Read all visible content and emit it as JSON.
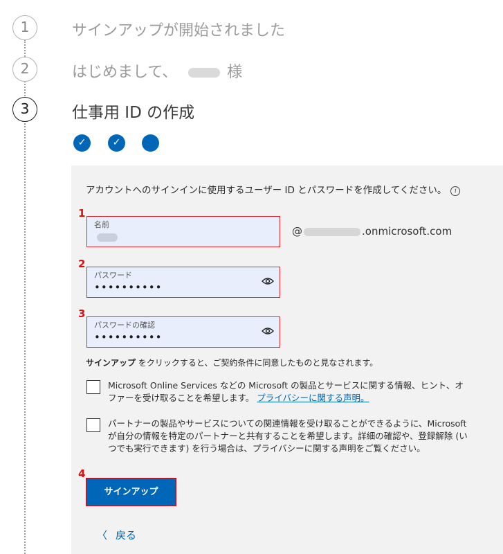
{
  "steps": [
    {
      "number": "1",
      "title": "サインアップが開始されました"
    },
    {
      "number": "2",
      "title_prefix": "はじめまして、",
      "title_suffix": "様"
    },
    {
      "number": "3",
      "title": "仕事用 ID の作成"
    }
  ],
  "progress": {
    "completed": 2,
    "current": 1
  },
  "form": {
    "intro": "アカウントへのサインインに使用するユーザー ID とパスワードを作成してください。",
    "fields": [
      {
        "marker": "1",
        "label": "名前",
        "value": ""
      },
      {
        "marker": "2",
        "label": "パスワード",
        "value": "••••••••••"
      },
      {
        "marker": "3",
        "label": "パスワードの確認",
        "value": "••••••••••"
      }
    ],
    "domain_prefix": "@",
    "domain_suffix": ".onmicrosoft.com",
    "terms_bold": "サインアップ",
    "terms_rest": " をクリックすると、ご契約条件に同意したものと見なされます。",
    "checkbox1_text": "Microsoft Online Services などの Microsoft の製品とサービスに関する情報、ヒント、オファーを受け取ることを希望します。",
    "checkbox1_link": "プライバシーに関する声明。",
    "checkbox2_text": "パートナーの製品やサービスについての関連情報を受け取ることができるように、Microsoft が自分の情報を特定のパートナーと共有することを希望します。詳細の確認や、登録解除 (いつでも実行できます) を行う場合は、プライバシーに関する声明をご覧ください。",
    "button_marker": "4",
    "signup_label": "サインアップ",
    "back_label": "戻る"
  },
  "colors": {
    "accent": "#0067b8",
    "highlight": "#e0242e",
    "field_bg": "#e8eefb",
    "panel_bg": "#f2f2f2"
  }
}
